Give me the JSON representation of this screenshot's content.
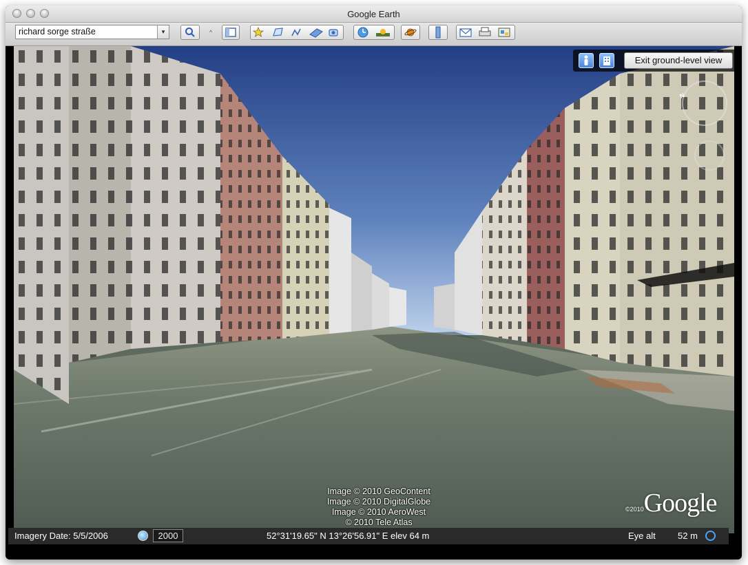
{
  "window": {
    "title": "Google Earth"
  },
  "search": {
    "value": "richard sorge straße",
    "dropdown_glyph": "▾"
  },
  "toolbar": {
    "buttons": [
      "search-icon",
      "sidebar-toggle-icon",
      "add-placemark-icon",
      "add-polygon-icon",
      "add-path-icon",
      "add-image-overlay-icon",
      "record-tour-icon",
      "historical-imagery-icon",
      "sunlight-icon",
      "planets-icon",
      "ruler-icon",
      "email-icon",
      "print-icon",
      "view-in-maps-icon"
    ]
  },
  "ground_view": {
    "exit_label": "Exit ground-level view"
  },
  "navigation": {
    "north_label": "N"
  },
  "attribution": {
    "lines": [
      "Image © 2010 GeoContent",
      "Image © 2010 DigitalGlobe",
      "Image © 2010 AeroWest",
      "© 2010 Tele Atlas"
    ]
  },
  "logo": {
    "year": "©2010",
    "word": "Google"
  },
  "status": {
    "imagery_date": "Imagery Date: 5/5/2006",
    "year": "2000",
    "coords": "52°31'19.65\" N  13°26'56.91\" E  elev   64 m",
    "eye_alt_label": "Eye alt",
    "eye_alt_value": "52 m"
  },
  "colors": {
    "sky": "#2f4f92",
    "status_bg": "#2a2a2a",
    "accent": "#4c86d9"
  }
}
